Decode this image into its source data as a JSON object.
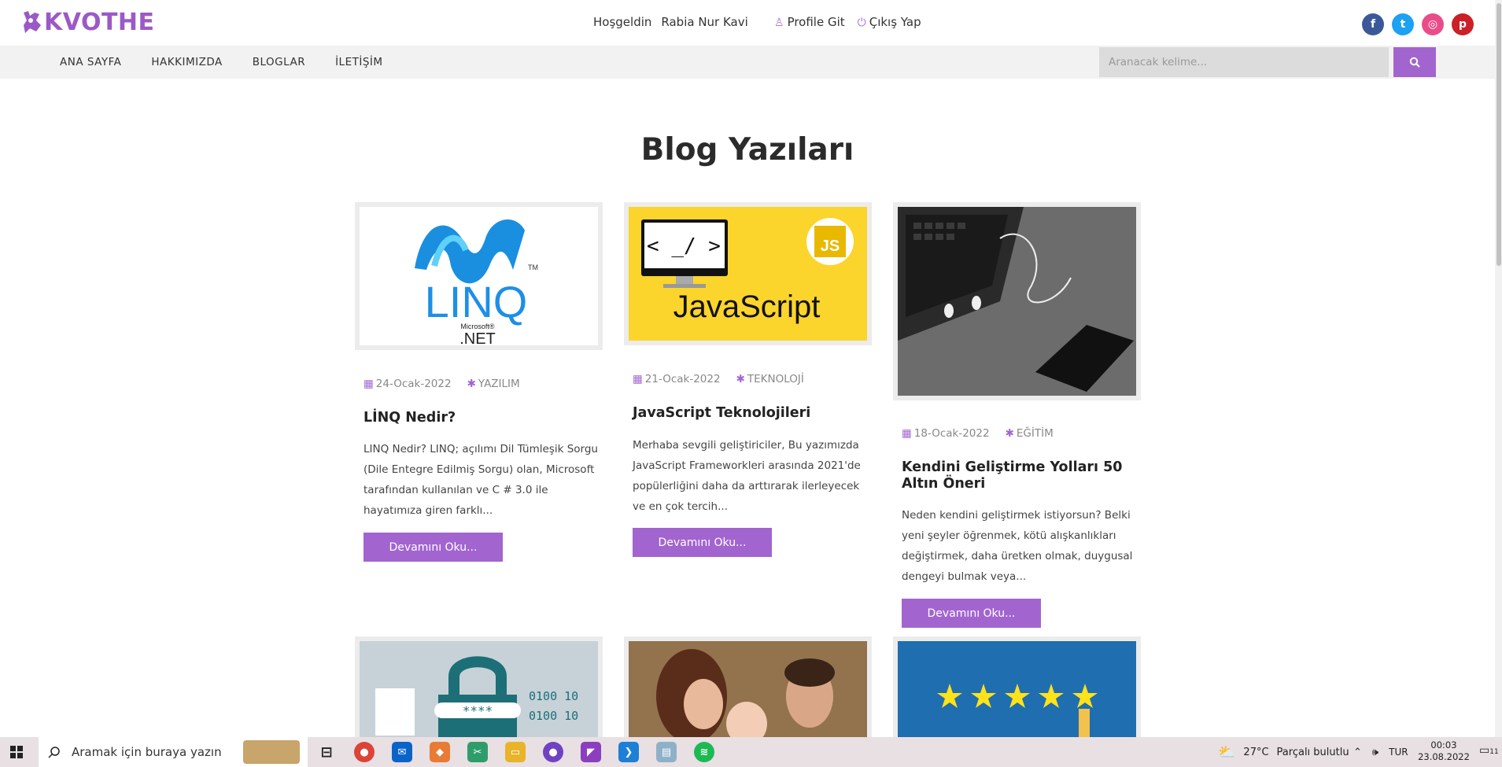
{
  "brand": {
    "name": "KVOTHE",
    "color": "#9b59c6",
    "accent": "#a265cf"
  },
  "header": {
    "welcome": "Hoşgeldin",
    "user": "Rabia Nur Kavi",
    "profile": "Profile Git",
    "logout": "Çıkış Yap",
    "social": [
      {
        "name": "facebook-icon",
        "glyph": "f",
        "color": "#3b5998"
      },
      {
        "name": "twitter-icon",
        "glyph": "t",
        "color": "#1da1f2"
      },
      {
        "name": "dribbble-icon",
        "glyph": "◎",
        "color": "#ea4c89"
      },
      {
        "name": "pinterest-icon",
        "glyph": "p",
        "color": "#cb2027"
      }
    ]
  },
  "nav": {
    "items": [
      "ANA SAYFA",
      "HAKKIMIZDA",
      "BLOGLAR",
      "İLETİŞİM"
    ],
    "search_placeholder": "Aranacak kelime..."
  },
  "page": {
    "title": "Blog Yazıları"
  },
  "posts": [
    {
      "date": "24-Ocak-2022",
      "category": "YAZILIM",
      "title": "LİNQ Nedir?",
      "excerpt": "LINQ Nedir? LINQ; açılımı Dil Tümleşik Sorgu (Dile Entegre Edilmiş Sorgu) olan, Microsoft tarafından kullanılan ve C # 3.0 ile hayatımıza giren farklı...",
      "button": "Devamını Oku...",
      "image_text": "LINQ",
      "image_sub1": "Microsoft®",
      "image_sub2": ".NET",
      "image_tm": "TM"
    },
    {
      "date": "21-Ocak-2022",
      "category": "TEKNOLOJİ",
      "title": "JavaScript Teknolojileri",
      "excerpt": "Merhaba sevgili geliştiriciler, Bu yazımızda JavaScript Frameworkleri arasında 2021'de popülerliğini daha da arttırarak ilerleyecek ve en çok tercih...",
      "button": "Devamını Oku...",
      "image_text": "JavaScript",
      "image_code": "< _/ >",
      "image_badge": "JS"
    },
    {
      "date": "18-Ocak-2022",
      "category": "EĞİTİM",
      "title": "Kendini Geliştirme Yolları 50 Altın Öneri",
      "excerpt": "Neden kendini geliştirmek istiyorsun? Belki yeni şeyler öğrenmek, kötü alışkanlıkları değiştirmek, daha üretken olmak, duygusal dengeyi bulmak veya...",
      "button": "Devamını Oku..."
    }
  ],
  "row2": {
    "lock_code": "****",
    "bits1": "0100 10",
    "bits2": "0100 10"
  },
  "taskbar": {
    "search_placeholder": "Aramak için buraya yazın",
    "weather_temp": "27°C",
    "weather_text": "Parçalı bulutlu",
    "lang": "TUR",
    "time": "00:03",
    "date": "23.08.2022",
    "notif": "11"
  }
}
